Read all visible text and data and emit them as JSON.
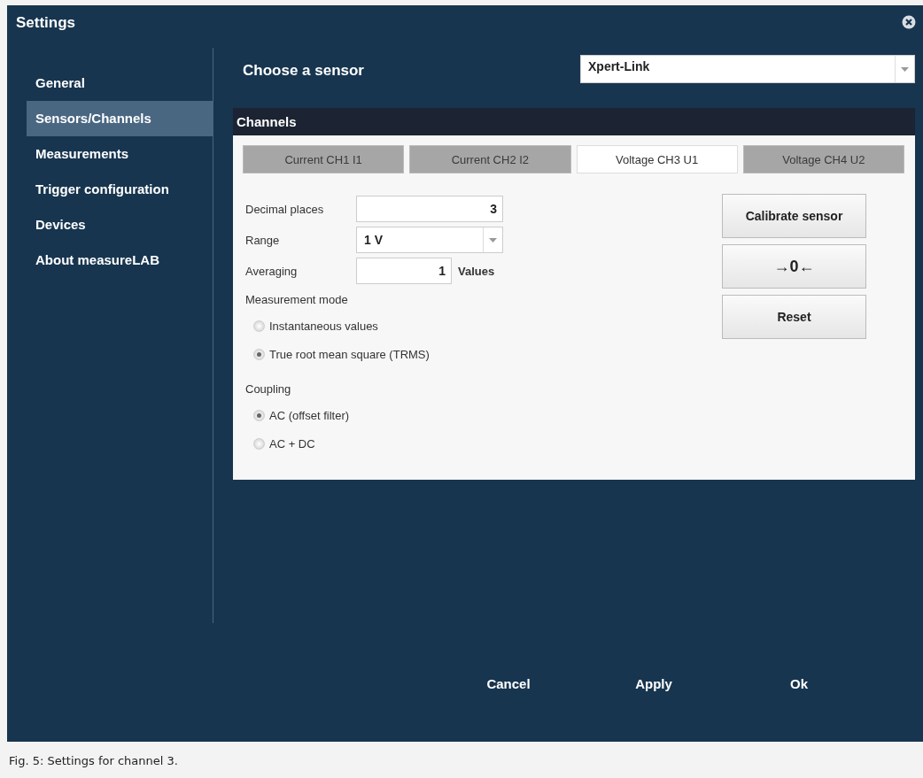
{
  "window": {
    "title": "Settings"
  },
  "sidebar": {
    "items": [
      {
        "label": "General",
        "selected": false
      },
      {
        "label": "Sensors/Channels",
        "selected": true
      },
      {
        "label": "Measurements",
        "selected": false
      },
      {
        "label": "Trigger configuration",
        "selected": false
      },
      {
        "label": "Devices",
        "selected": false
      },
      {
        "label": "About measureLAB",
        "selected": false
      }
    ]
  },
  "sensor": {
    "label": "Choose a sensor",
    "value": "Xpert-Link"
  },
  "channels": {
    "title": "Channels",
    "tabs": [
      {
        "label": "Current CH1 I1",
        "selected": false
      },
      {
        "label": "Current CH2 I2",
        "selected": false
      },
      {
        "label": "Voltage CH3 U1",
        "selected": true
      },
      {
        "label": "Voltage CH4 U2",
        "selected": false
      }
    ],
    "decimal_places": {
      "label": "Decimal places",
      "value": "3"
    },
    "range": {
      "label": "Range",
      "value": "1 V"
    },
    "averaging": {
      "label": "Averaging",
      "value": "1",
      "unit": "Values"
    },
    "measurement_mode": {
      "label": "Measurement mode",
      "options": [
        {
          "label": "Instantaneous values",
          "selected": false
        },
        {
          "label": "True root mean square (TRMS)",
          "selected": true
        }
      ]
    },
    "coupling": {
      "label": "Coupling",
      "options": [
        {
          "label": "AC (offset filter)",
          "selected": true
        },
        {
          "label": "AC + DC",
          "selected": false
        }
      ]
    },
    "buttons": [
      "Calibrate sensor",
      "→0←",
      "Reset"
    ]
  },
  "footer_buttons": [
    "Cancel",
    "Apply",
    "Ok"
  ],
  "caption": "Fig. 5: Settings for channel 3."
}
